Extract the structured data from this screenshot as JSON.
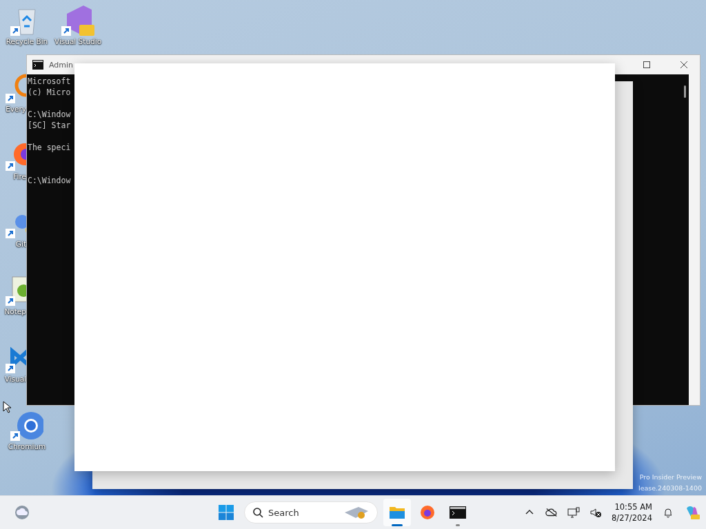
{
  "desktop_icons": [
    {
      "label": "Recycle Bin",
      "kind": "recycle"
    },
    {
      "label": "Visual Studio",
      "kind": "vs"
    },
    {
      "label": "Every",
      "kind": "everything"
    },
    {
      "label": "Fire",
      "kind": "firefox"
    },
    {
      "label": "Git",
      "kind": "git"
    },
    {
      "label": "Notep",
      "kind": "notepad"
    },
    {
      "label": "Visual",
      "kind": "vscode"
    },
    {
      "label": "Chromium",
      "kind": "chromium"
    }
  ],
  "console_window": {
    "title": "Admin",
    "paragraphs": [
      [
        "Microsoft",
        "(c) Micro"
      ],
      [
        "C:\\Window",
        "[SC] Star"
      ],
      [
        "The speci"
      ],
      [
        "C:\\Window"
      ]
    ]
  },
  "watermark": [
    "Pro Insider Preview",
    "lease.240308-1400"
  ],
  "taskbar": {
    "search": {
      "placeholder": "Search"
    },
    "apps": [
      {
        "kind": "explorer",
        "active": true
      },
      {
        "kind": "firefox",
        "active": false
      },
      {
        "kind": "terminal",
        "active": false,
        "running": true
      }
    ],
    "clock": {
      "time": "10:55 AM",
      "date": "8/27/2024"
    }
  }
}
